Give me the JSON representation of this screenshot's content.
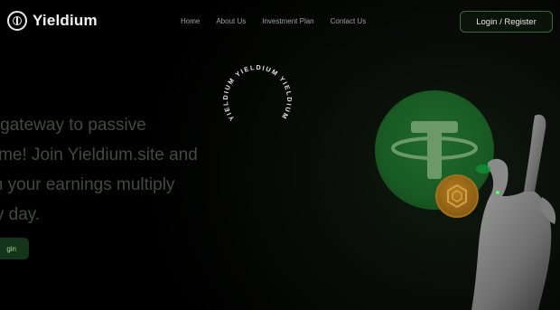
{
  "brand": {
    "name": "Yieldium"
  },
  "nav": {
    "items": [
      {
        "label": "Home"
      },
      {
        "label": "About Us"
      },
      {
        "label": "Investment Plan"
      },
      {
        "label": "Contact Us"
      }
    ]
  },
  "header": {
    "login_label": "Login / Register"
  },
  "badge": {
    "ring_text": "YIELDIUM YIELDIUM YIELDIUM"
  },
  "hero": {
    "lines": [
      "ur gateway to passive",
      "come! Join Yieldium.site and",
      "tch your earnings multiply",
      "ery day."
    ],
    "cta_label": "gin"
  },
  "colors": {
    "background": "#000000",
    "accent_green": "#195a24",
    "accent_orange": "#8a5d14",
    "button_border": "#3f6a38"
  },
  "icons": {
    "logo": "yieldium-logo-icon",
    "tether": "tether-coin-icon",
    "coin": "token-coin-icon"
  }
}
